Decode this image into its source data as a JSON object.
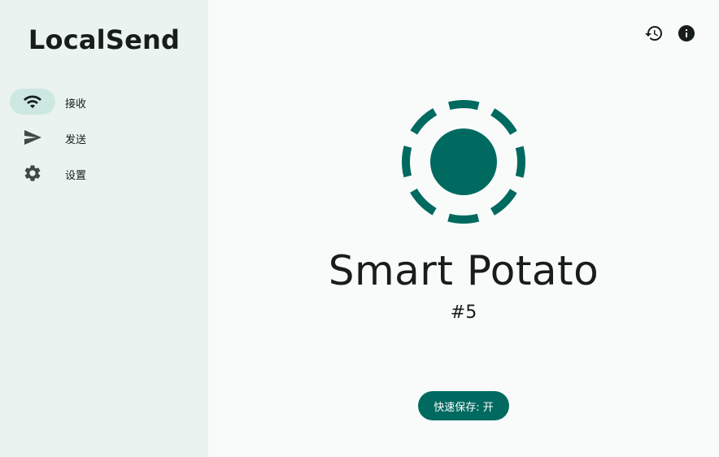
{
  "app": {
    "title": "LocalSend"
  },
  "colors": {
    "accent": "#006a60",
    "sidebar_bg": "#eaf3f0",
    "active_pill": "#cde8e1",
    "text": "#161d1c"
  },
  "nav": {
    "items": [
      {
        "label": "接收",
        "icon": "wifi-icon",
        "active": true
      },
      {
        "label": "发送",
        "icon": "send-icon",
        "active": false
      },
      {
        "label": "设置",
        "icon": "gear-icon",
        "active": false
      }
    ]
  },
  "toolbar": {
    "history_icon": "history-icon",
    "info_icon": "info-icon"
  },
  "device": {
    "name": "Smart Potato",
    "id": "#5"
  },
  "quick_save": {
    "label": "快速保存: 开"
  }
}
